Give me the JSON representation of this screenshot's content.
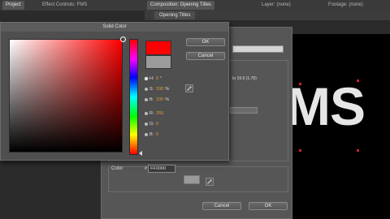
{
  "panels": {
    "project_tab": "Project",
    "effect_controls_tab": "Effect Controls: FMS",
    "composition_tab": "Composition: Opening Titles",
    "layer_tab": "Layer: (none)",
    "footage_tab": "Footage: (none)",
    "composition_subtab": "Opening Titles"
  },
  "viewer": {
    "text": "MS"
  },
  "background_dialog": {
    "aspect_text": "to 16:9 (1.78)",
    "color_label": "Color",
    "cancel_label": "Cancel",
    "ok_label": "OK",
    "swatch_color": "#9a9a9a"
  },
  "solid_color": {
    "title": "Solid Color",
    "ok_label": "OK",
    "cancel_label": "Cancel",
    "new_color": "#ff0000",
    "current_color": "#9b9b9b",
    "fields": [
      {
        "label": "H:",
        "value": "0",
        "unit": "°",
        "selected": true
      },
      {
        "label": "S:",
        "value": "100",
        "unit": "%",
        "selected": false
      },
      {
        "label": "B:",
        "value": "100",
        "unit": "%",
        "selected": false
      },
      {
        "label": "R:",
        "value": "255",
        "unit": "",
        "selected": false
      },
      {
        "label": "G:",
        "value": "0",
        "unit": "",
        "selected": false
      },
      {
        "label": "B:",
        "value": "0",
        "unit": "",
        "selected": false
      }
    ],
    "hex_label": "#",
    "hex_value": "FF0000"
  }
}
